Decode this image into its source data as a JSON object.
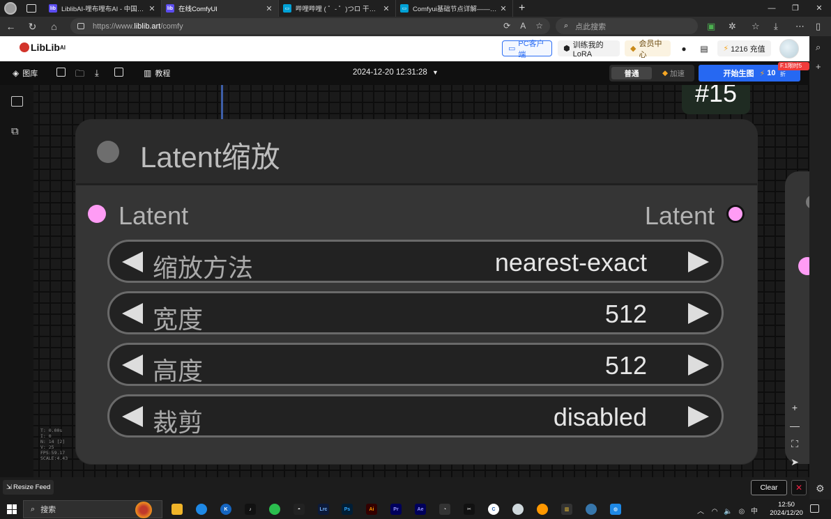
{
  "browser": {
    "tabs": [
      {
        "title": "LiblibAI-哩布哩布AI - 中国领先的",
        "favicon": "liblib-icon",
        "active": false
      },
      {
        "title": "在线ComfyUI",
        "favicon": "liblib-icon",
        "active": true
      },
      {
        "title": "哔哩哔哩 ( ゜- ゜)つロ 干杯~-bilib",
        "favicon": "bilibili-icon",
        "active": false
      },
      {
        "title": "Comfyui基础节点详解——Latent",
        "favicon": "bilibili-icon",
        "active": false
      }
    ],
    "url_prefix": "https://www.",
    "url_host": "liblib.art",
    "url_path": "/comfy",
    "search_placeholder": "点此搜索"
  },
  "site_header": {
    "logo": "LibLib",
    "logo_sup": "AI",
    "pc_client": "PC客户端",
    "train_lora": "训练我的LoRA",
    "member_center": "会员中心",
    "credits": "1216 充值"
  },
  "toolbar": {
    "gallery": "图库",
    "tutorial": "教程",
    "datetime": "2024-12-20 12:31:28",
    "mode_normal": "普通",
    "mode_fast": "加速",
    "generate": "开始生图",
    "generate_cost": "10",
    "promo": "F.1限时5折"
  },
  "node": {
    "id": "#15",
    "title": "Latent缩放",
    "input_label": "Latent",
    "output_label": "Latent",
    "slot_color": "#ff9cf5",
    "widgets": [
      {
        "label": "缩放方法",
        "value": "nearest-exact"
      },
      {
        "label": "宽度",
        "value": "512"
      },
      {
        "label": "高度",
        "value": "512"
      },
      {
        "label": "裁剪",
        "value": "disabled"
      }
    ]
  },
  "stats": {
    "t": "T: 0.00s",
    "i": "I: 0",
    "n": "N: 14 [2]",
    "v": "V: 25",
    "fps": "FPS:59.17",
    "scale": "SCALE:4.43"
  },
  "bottom": {
    "resize_feed": "Resize Feed",
    "clear": "Clear"
  },
  "taskbar": {
    "search": "搜索",
    "time": "12:50",
    "date": "2024/12/20",
    "ime": "中"
  },
  "colors": {
    "accent_blue": "#2668f2",
    "slot_pink": "#ff9cf5",
    "promo_red": "#f13b3b"
  }
}
